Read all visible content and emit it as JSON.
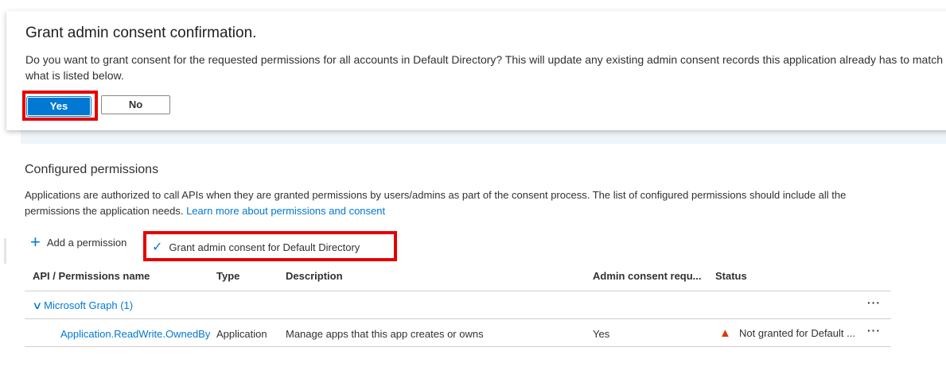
{
  "dialog": {
    "title": "Grant admin consent confirmation.",
    "message": "Do you want to grant consent for the requested permissions for all accounts in Default Directory? This will update any existing admin consent records this application already has to match what is listed below.",
    "yes": "Yes",
    "no": "No"
  },
  "section": {
    "title": "Configured permissions",
    "description": "Applications are authorized to call APIs when they are granted permissions by users/admins as part of the consent process. The list of configured permissions should include all the permissions the application needs.",
    "learn_more": "Learn more about permissions and consent"
  },
  "toolbar": {
    "add": "Add a permission",
    "grant": "Grant admin consent for Default Directory"
  },
  "table": {
    "headers": [
      "API / Permissions name",
      "Type",
      "Description",
      "Admin consent requ...",
      "Status"
    ],
    "group": "Microsoft Graph (1)",
    "rows": [
      {
        "name": "Application.ReadWrite.OwnedBy",
        "type": "Application",
        "description": "Manage apps that this app creates or owns",
        "admin": "Yes",
        "status": "Not granted for Default ..."
      }
    ]
  },
  "colors": {
    "accent": "#0078d4",
    "highlight": "#e50000",
    "warning": "#d83b01"
  }
}
